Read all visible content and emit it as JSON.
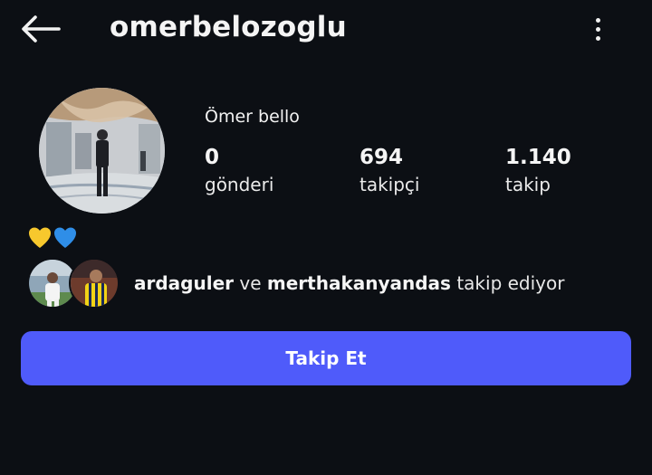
{
  "header": {
    "back_icon": "arrow-left-icon",
    "username": "omerbelozoglu",
    "more_icon": "more-vertical-icon"
  },
  "profile": {
    "display_name": "Ömer bello",
    "stats": [
      {
        "value": "0",
        "label": "gönderi"
      },
      {
        "value": "694",
        "label": "takipçi"
      },
      {
        "value": "1.140",
        "label": "takip"
      }
    ],
    "bio_icons": [
      "yellow-heart-icon",
      "blue-heart-icon"
    ]
  },
  "followed_by": {
    "user1": "ardaguler",
    "connector": "ve",
    "user2": "merthakanyandas",
    "suffix": "takip ediyor"
  },
  "follow_button": {
    "label": "Takip Et"
  },
  "colors": {
    "background": "#0c0f14",
    "button": "#4f5bfa",
    "text": "#f5f5f5",
    "yellow_heart": "#f7c82d",
    "blue_heart": "#2f8ee8"
  }
}
